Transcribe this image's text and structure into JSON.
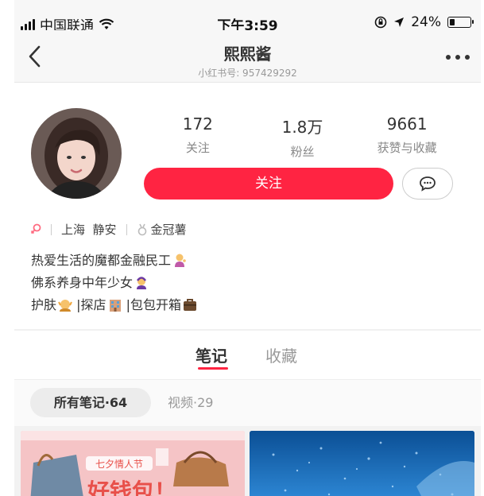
{
  "status_bar": {
    "carrier": "中国联通",
    "time": "下午3:59",
    "battery_percent": "24%",
    "battery_level": 0.24,
    "icons": [
      "signal-icon",
      "wifi-icon",
      "orientation-lock-icon",
      "location-icon",
      "battery-icon"
    ]
  },
  "nav": {
    "title": "熙熙酱",
    "subtitle": "小红书号: 957429292",
    "icons": [
      "back-icon",
      "more-icon"
    ]
  },
  "profile": {
    "stats": [
      {
        "value": "172",
        "label": "关注"
      },
      {
        "value": "1.8万",
        "label": "粉丝"
      },
      {
        "value": "9661",
        "label": "获赞与收藏"
      }
    ],
    "follow_label": "关注",
    "location": "上海  静安",
    "badge": "金冠薯",
    "bio_lines": [
      "热爱生活的魔都金融民工",
      "佛系养身中年少女",
      "护肤",
      "|探店",
      "|包包开箱"
    ]
  },
  "tabs": {
    "notes": "笔记",
    "collect": "收藏"
  },
  "filters": {
    "all_notes": "所有笔记·64",
    "videos": "视频·29"
  },
  "thumbnails": {
    "note1_tag": "七夕情人节",
    "note1_headline": "好钱包！"
  },
  "colors": {
    "accent": "#ff2442",
    "nav_bg": "#f7f7f7"
  }
}
